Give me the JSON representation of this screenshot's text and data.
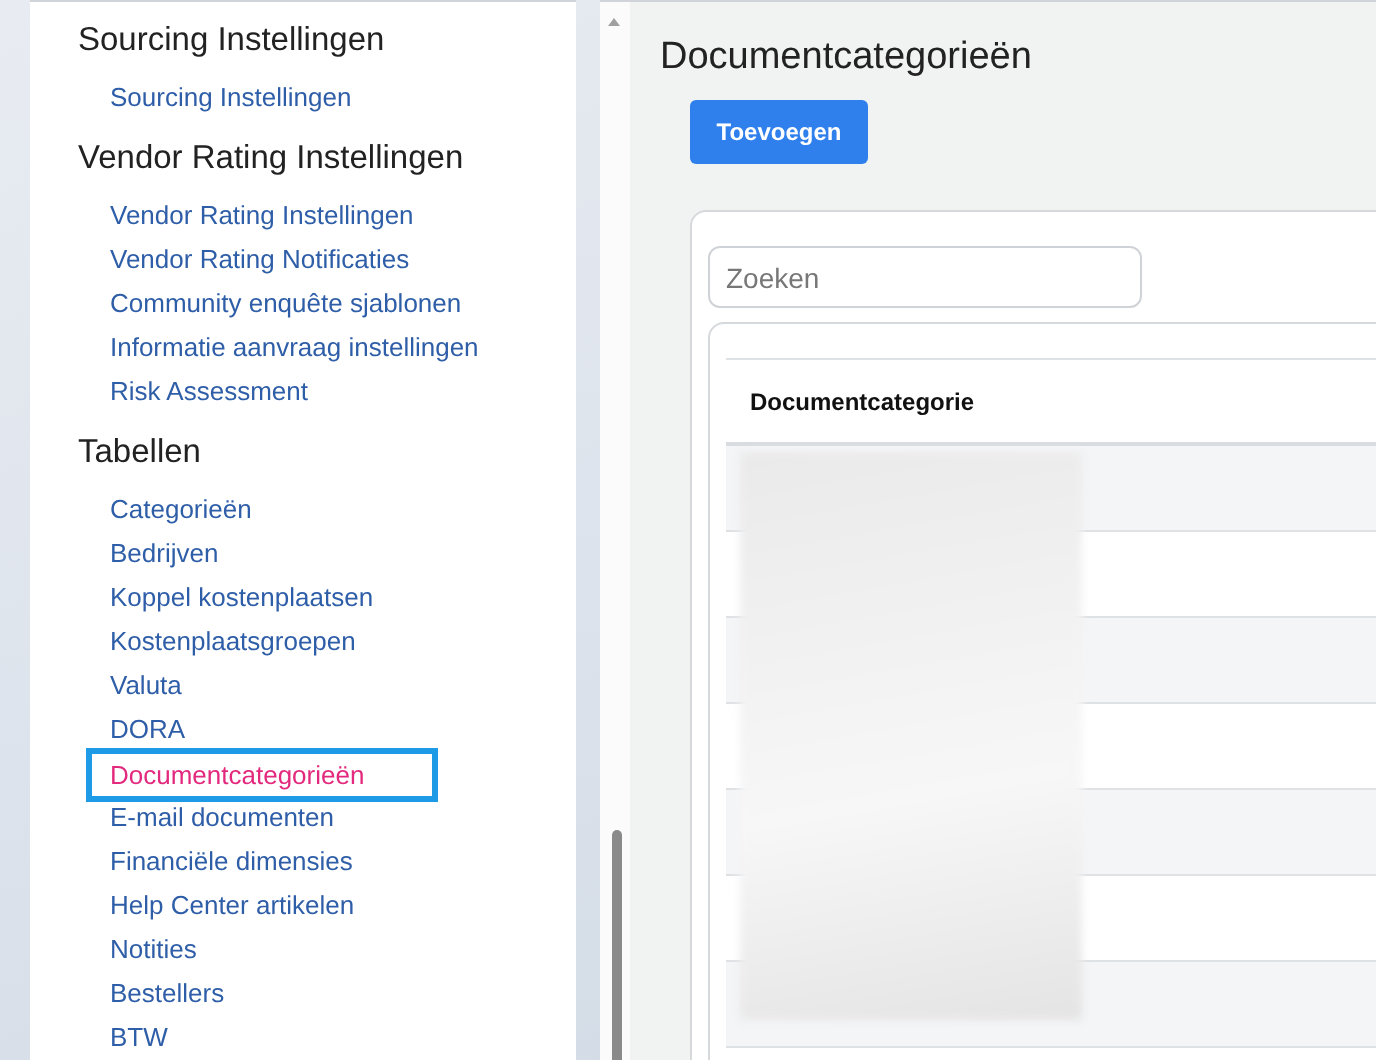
{
  "sidebar": {
    "sections": [
      {
        "heading": "Sourcing Instellingen",
        "items": [
          {
            "label": "Sourcing Instellingen",
            "selected": false
          }
        ]
      },
      {
        "heading": "Vendor Rating Instellingen",
        "items": [
          {
            "label": "Vendor Rating Instellingen",
            "selected": false
          },
          {
            "label": "Vendor Rating Notificaties",
            "selected": false
          },
          {
            "label": "Community enquête sjablonen",
            "selected": false
          },
          {
            "label": "Informatie aanvraag instellingen",
            "selected": false
          },
          {
            "label": "Risk Assessment",
            "selected": false
          }
        ]
      },
      {
        "heading": "Tabellen",
        "items": [
          {
            "label": "Categorieën",
            "selected": false
          },
          {
            "label": "Bedrijven",
            "selected": false
          },
          {
            "label": "Koppel kostenplaatsen",
            "selected": false
          },
          {
            "label": "Kostenplaatsgroepen",
            "selected": false
          },
          {
            "label": "Valuta",
            "selected": false
          },
          {
            "label": "DORA",
            "selected": false
          },
          {
            "label": "Documentcategorieën",
            "selected": true
          },
          {
            "label": "E-mail documenten",
            "selected": false
          },
          {
            "label": "Financiële dimensies",
            "selected": false
          },
          {
            "label": "Help Center artikelen",
            "selected": false
          },
          {
            "label": "Notities",
            "selected": false
          },
          {
            "label": "Bestellers",
            "selected": false
          },
          {
            "label": "BTW",
            "selected": false
          }
        ]
      }
    ]
  },
  "main": {
    "title": "Documentcategorieën",
    "add_button": "Toevoegen",
    "search": {
      "placeholder": "Zoeken"
    },
    "table": {
      "columns": [
        "Documentcategorie"
      ]
    }
  }
}
